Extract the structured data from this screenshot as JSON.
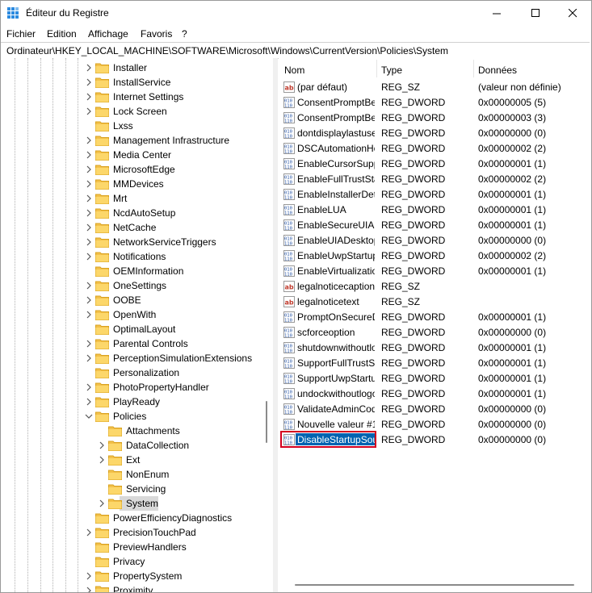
{
  "window": {
    "title": "Éditeur du Registre"
  },
  "menu": [
    "Fichier",
    "Edition",
    "Affichage",
    "Favoris",
    "?"
  ],
  "address": "Ordinateur\\HKEY_LOCAL_MACHINE\\SOFTWARE\\Microsoft\\Windows\\CurrentVersion\\Policies\\System",
  "tree": [
    {
      "label": "Installer",
      "level": 0,
      "expander": "collapsed"
    },
    {
      "label": "InstallService",
      "level": 0,
      "expander": "collapsed"
    },
    {
      "label": "Internet Settings",
      "level": 0,
      "expander": "collapsed"
    },
    {
      "label": "Lock Screen",
      "level": 0,
      "expander": "collapsed"
    },
    {
      "label": "Lxss",
      "level": 0,
      "expander": "none"
    },
    {
      "label": "Management Infrastructure",
      "level": 0,
      "expander": "collapsed"
    },
    {
      "label": "Media Center",
      "level": 0,
      "expander": "collapsed"
    },
    {
      "label": "MicrosoftEdge",
      "level": 0,
      "expander": "collapsed"
    },
    {
      "label": "MMDevices",
      "level": 0,
      "expander": "collapsed"
    },
    {
      "label": "Mrt",
      "level": 0,
      "expander": "collapsed"
    },
    {
      "label": "NcdAutoSetup",
      "level": 0,
      "expander": "collapsed"
    },
    {
      "label": "NetCache",
      "level": 0,
      "expander": "collapsed"
    },
    {
      "label": "NetworkServiceTriggers",
      "level": 0,
      "expander": "collapsed"
    },
    {
      "label": "Notifications",
      "level": 0,
      "expander": "collapsed"
    },
    {
      "label": "OEMInformation",
      "level": 0,
      "expander": "none"
    },
    {
      "label": "OneSettings",
      "level": 0,
      "expander": "collapsed"
    },
    {
      "label": "OOBE",
      "level": 0,
      "expander": "collapsed"
    },
    {
      "label": "OpenWith",
      "level": 0,
      "expander": "collapsed"
    },
    {
      "label": "OptimalLayout",
      "level": 0,
      "expander": "none"
    },
    {
      "label": "Parental Controls",
      "level": 0,
      "expander": "collapsed"
    },
    {
      "label": "PerceptionSimulationExtensions",
      "level": 0,
      "expander": "collapsed"
    },
    {
      "label": "Personalization",
      "level": 0,
      "expander": "none"
    },
    {
      "label": "PhotoPropertyHandler",
      "level": 0,
      "expander": "collapsed"
    },
    {
      "label": "PlayReady",
      "level": 0,
      "expander": "collapsed"
    },
    {
      "label": "Policies",
      "level": 0,
      "expander": "expanded"
    },
    {
      "label": "Attachments",
      "level": 1,
      "expander": "none"
    },
    {
      "label": "DataCollection",
      "level": 1,
      "expander": "collapsed"
    },
    {
      "label": "Ext",
      "level": 1,
      "expander": "collapsed"
    },
    {
      "label": "NonEnum",
      "level": 1,
      "expander": "none"
    },
    {
      "label": "Servicing",
      "level": 1,
      "expander": "none"
    },
    {
      "label": "System",
      "level": 1,
      "expander": "collapsed",
      "selected": true
    },
    {
      "label": "PowerEfficiencyDiagnostics",
      "level": 0,
      "expander": "none"
    },
    {
      "label": "PrecisionTouchPad",
      "level": 0,
      "expander": "collapsed"
    },
    {
      "label": "PreviewHandlers",
      "level": 0,
      "expander": "none"
    },
    {
      "label": "Privacy",
      "level": 0,
      "expander": "none"
    },
    {
      "label": "PropertySystem",
      "level": 0,
      "expander": "collapsed"
    },
    {
      "label": "Proximity",
      "level": 0,
      "expander": "collapsed"
    }
  ],
  "list": {
    "headers": {
      "name": "Nom",
      "type": "Type",
      "data": "Données"
    },
    "rows": [
      {
        "kind": "sz",
        "name": "(par défaut)",
        "type": "REG_SZ",
        "data": "(valeur non définie)"
      },
      {
        "kind": "dword",
        "name": "ConsentPromptBehaviorAdmin",
        "type": "REG_DWORD",
        "data": "0x00000005 (5)"
      },
      {
        "kind": "dword",
        "name": "ConsentPromptBehaviorUser",
        "type": "REG_DWORD",
        "data": "0x00000003 (3)"
      },
      {
        "kind": "dword",
        "name": "dontdisplaylastusername",
        "type": "REG_DWORD",
        "data": "0x00000000 (0)"
      },
      {
        "kind": "dword",
        "name": "DSCAutomationHostEnabled",
        "type": "REG_DWORD",
        "data": "0x00000002 (2)"
      },
      {
        "kind": "dword",
        "name": "EnableCursorSuppression",
        "type": "REG_DWORD",
        "data": "0x00000001 (1)"
      },
      {
        "kind": "dword",
        "name": "EnableFullTrustStartupTasks",
        "type": "REG_DWORD",
        "data": "0x00000002 (2)"
      },
      {
        "kind": "dword",
        "name": "EnableInstallerDetection",
        "type": "REG_DWORD",
        "data": "0x00000001 (1)"
      },
      {
        "kind": "dword",
        "name": "EnableLUA",
        "type": "REG_DWORD",
        "data": "0x00000001 (1)"
      },
      {
        "kind": "dword",
        "name": "EnableSecureUIAPaths",
        "type": "REG_DWORD",
        "data": "0x00000001 (1)"
      },
      {
        "kind": "dword",
        "name": "EnableUIADesktopToggle",
        "type": "REG_DWORD",
        "data": "0x00000000 (0)"
      },
      {
        "kind": "dword",
        "name": "EnableUwpStartupTasks",
        "type": "REG_DWORD",
        "data": "0x00000002 (2)"
      },
      {
        "kind": "dword",
        "name": "EnableVirtualization",
        "type": "REG_DWORD",
        "data": "0x00000001 (1)"
      },
      {
        "kind": "sz",
        "name": "legalnoticecaption",
        "type": "REG_SZ",
        "data": ""
      },
      {
        "kind": "sz",
        "name": "legalnoticetext",
        "type": "REG_SZ",
        "data": ""
      },
      {
        "kind": "dword",
        "name": "PromptOnSecureDesktop",
        "type": "REG_DWORD",
        "data": "0x00000001 (1)"
      },
      {
        "kind": "dword",
        "name": "scforceoption",
        "type": "REG_DWORD",
        "data": "0x00000000 (0)"
      },
      {
        "kind": "dword",
        "name": "shutdownwithoutlogon",
        "type": "REG_DWORD",
        "data": "0x00000001 (1)"
      },
      {
        "kind": "dword",
        "name": "SupportFullTrustStartupTasks",
        "type": "REG_DWORD",
        "data": "0x00000001 (1)"
      },
      {
        "kind": "dword",
        "name": "SupportUwpStartupTasks",
        "type": "REG_DWORD",
        "data": "0x00000001 (1)"
      },
      {
        "kind": "dword",
        "name": "undockwithoutlogon",
        "type": "REG_DWORD",
        "data": "0x00000001 (1)"
      },
      {
        "kind": "dword",
        "name": "ValidateAdminCodeSignatures",
        "type": "REG_DWORD",
        "data": "0x00000000 (0)"
      },
      {
        "kind": "dword",
        "name": "Nouvelle valeur #1",
        "type": "REG_DWORD",
        "data": "0x00000000 (0)"
      },
      {
        "kind": "dword",
        "name": "DisableStartupSound",
        "type": "REG_DWORD",
        "data": "0x00000000 (0)",
        "selected": true
      }
    ]
  },
  "colors": {
    "selection": "#0063b1",
    "highlight_box": "#d4001e",
    "folder": "#f3c14b"
  }
}
